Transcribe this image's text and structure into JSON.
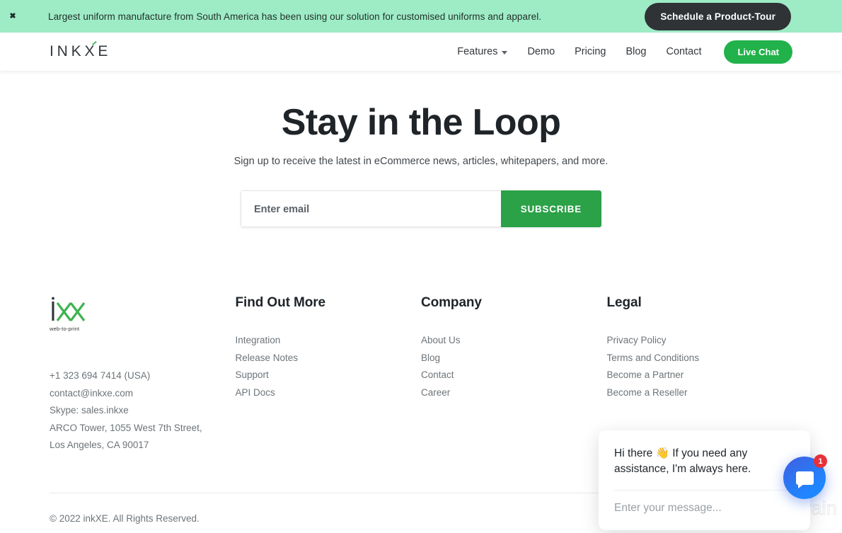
{
  "promo_banner": {
    "close_icon": "close-icon",
    "message": "Largest uniform manufacture from South America has been using our solution for customised uniforms and apparel.",
    "cta_label": "Schedule a Product-Tour",
    "background_color": "#9eecc6",
    "cta_color": "#2f3336"
  },
  "header": {
    "brand": {
      "part1": "INK",
      "part2": "X",
      "part3": "E"
    },
    "nav": [
      {
        "label": "Features",
        "has_dropdown": true
      },
      {
        "label": "Demo",
        "has_dropdown": false
      },
      {
        "label": "Pricing",
        "has_dropdown": false
      },
      {
        "label": "Blog",
        "has_dropdown": false
      },
      {
        "label": "Contact",
        "has_dropdown": false
      }
    ],
    "live_chat_label": "Live Chat",
    "live_chat_color": "#21b24b"
  },
  "newsletter": {
    "title": "Stay in the Loop",
    "subtitle": "Sign up to receive the latest in eCommerce news, articles, whitepapers, and more.",
    "email_placeholder": "Enter email",
    "email_value": "",
    "subscribe_label": "SUBSCRIBE",
    "subscribe_color": "#2ba148"
  },
  "footer": {
    "logo": {
      "letter": "i",
      "tagline": "web-to-print",
      "accent_color": "#3fb34f"
    },
    "contact": [
      "+1 323 694 7414 (USA)",
      "contact@inkxe.com",
      "Skype: sales.inkxe",
      "ARCO Tower, 1055 West 7th Street,",
      "Los Angeles, CA 90017"
    ],
    "columns": [
      {
        "heading": "Find Out More",
        "links": [
          "Integration",
          "Release Notes",
          "Support",
          "API Docs"
        ]
      },
      {
        "heading": "Company",
        "links": [
          "About Us",
          "Blog",
          "Contact",
          "Career"
        ]
      },
      {
        "heading": "Legal",
        "links": [
          "Privacy Policy",
          "Terms and Conditions",
          "Become a Partner",
          "Become a Reseller"
        ]
      }
    ],
    "copyright": "© 2022 inkXE. All Rights Reserved."
  },
  "chat_widget": {
    "greeting_before": "Hi there ",
    "greeting_emoji": "👋",
    "greeting_after": " If you need any assistance, I'm always here.",
    "input_placeholder": "Enter your message...",
    "input_value": "",
    "badge_count": "1",
    "fab_icon": "chat-bubble-icon",
    "fab_color": "#1f86ff",
    "badge_color": "#e8303a"
  },
  "watermark": {
    "text": "Revain"
  }
}
